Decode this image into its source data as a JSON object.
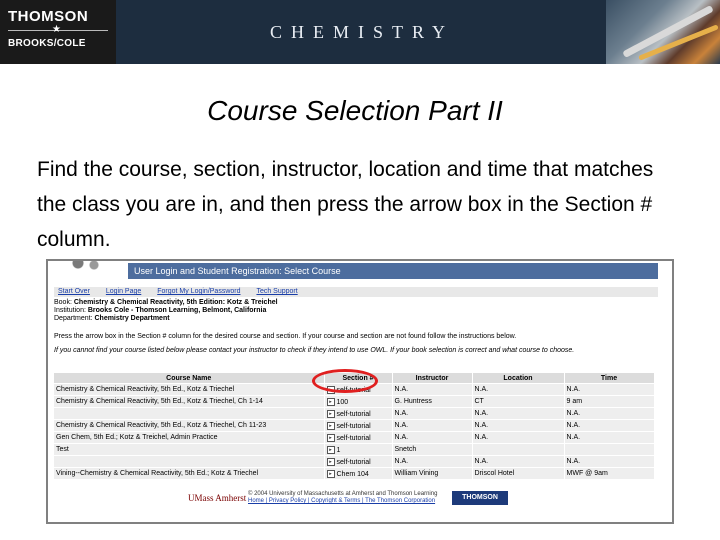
{
  "header": {
    "logo_line1": "THOMSON",
    "logo_star": "★",
    "logo_line2": "BROOKS/COLE",
    "title": "CHEMISTRY"
  },
  "slide": {
    "title": "Course Selection Part II",
    "body": "Find the course, section, instructor, location and time that matches the class you are in, and then press the arrow box in the Section # column."
  },
  "screenshot": {
    "page_title": "User Login and Student Registration: Select Course",
    "nav": [
      "Start Over",
      "Login Page",
      "Forgot My Login/Password",
      "Tech Support"
    ],
    "book_label": "Book:",
    "book_value": "Chemistry & Chemical Reactivity, 5th Edition: Kotz & Treichel",
    "institution_label": "Institution:",
    "institution_value": "Brooks Cole - Thomson Learning, Belmont, California",
    "department_label": "Department:",
    "department_value": "Chemistry Department",
    "note1": "Press the arrow box in the Section # column for the desired course and section. If your course and section are not found follow the instructions below.",
    "note2": "If you cannot find your course listed below please contact your instructor to check if they intend to use OWL. If your book selection is correct and what course to choose.",
    "columns": [
      "Course Name",
      "Section #",
      "Instructor",
      "Location",
      "Time"
    ],
    "rows": [
      {
        "course": "Chemistry & Chemical Reactivity, 5th Ed., Kotz & Triechel",
        "section": "self-tutorial",
        "instructor": "N.A.",
        "location": "N.A.",
        "time": "N.A."
      },
      {
        "course": "Chemistry & Chemical Reactivity, 5th Ed., Kotz & Triechel, Ch 1-14",
        "section": "100",
        "instructor": "G. Huntress",
        "location": "CT",
        "time": "9 am"
      },
      {
        "course": "",
        "section": "self-tutorial",
        "instructor": "N.A.",
        "location": "N.A.",
        "time": "N.A."
      },
      {
        "course": "Chemistry & Chemical Reactivity, 5th Ed., Kotz & Triechel, Ch 11-23",
        "section": "self-tutorial",
        "instructor": "N.A.",
        "location": "N.A.",
        "time": "N.A."
      },
      {
        "course": "Gen Chem, 5th Ed.; Kotz & Treichel, Admin Practice",
        "section": "self-tutorial",
        "instructor": "N.A.",
        "location": "N.A.",
        "time": "N.A."
      },
      {
        "course": "Test",
        "section": "1",
        "instructor": "Snetch",
        "location": "",
        "time": ""
      },
      {
        "course": "",
        "section": "self-tutorial",
        "instructor": "N.A.",
        "location": "N.A.",
        "time": "N.A."
      },
      {
        "course": "Vining--Chemistry & Chemical Reactivity, 5th Ed.; Kotz & Triechel",
        "section": "Chem 104",
        "instructor": "William Vining",
        "location": "Driscol Hotel",
        "time": "MWF @ 9am"
      }
    ],
    "footer_umass": "UMass Amherst",
    "footer_text": "© 2004 University of Massachusetts at Amherst and Thomson Learning",
    "footer_links": "Home | Privacy Policy | Copyright & Terms | The Thomson Corporation",
    "footer_logo": "THOMSON"
  },
  "colors": {
    "header_bg": "#1d2d3f",
    "table_header_bg": "#dcdcdc",
    "highlight_circle": "#e02020",
    "titlebar_bg": "#4d6d9e"
  }
}
